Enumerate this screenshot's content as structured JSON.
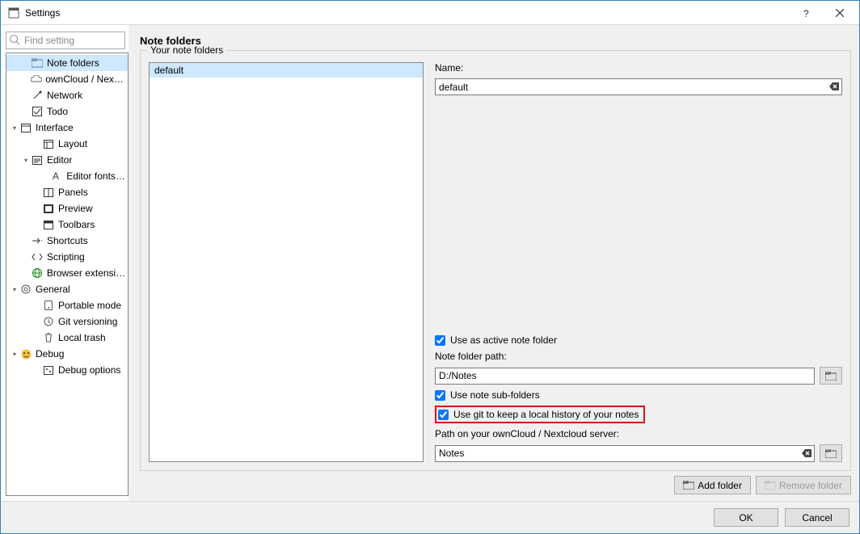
{
  "window": {
    "title": "Settings"
  },
  "sidebar": {
    "search_placeholder": "Find setting",
    "items": [
      {
        "label": "Note folders",
        "selected": true
      },
      {
        "label": "ownCloud / Nextcl..."
      },
      {
        "label": "Network"
      },
      {
        "label": "Todo"
      },
      {
        "label": "Interface"
      },
      {
        "label": "Layout"
      },
      {
        "label": "Editor"
      },
      {
        "label": "Editor fonts & ..."
      },
      {
        "label": "Panels"
      },
      {
        "label": "Preview"
      },
      {
        "label": "Toolbars"
      },
      {
        "label": "Shortcuts"
      },
      {
        "label": "Scripting"
      },
      {
        "label": "Browser extension"
      },
      {
        "label": "General"
      },
      {
        "label": "Portable mode"
      },
      {
        "label": "Git versioning"
      },
      {
        "label": "Local trash"
      },
      {
        "label": "Debug"
      },
      {
        "label": "Debug options"
      }
    ]
  },
  "panel": {
    "heading": "Note folders",
    "group_label": "Your note folders",
    "folders": [
      {
        "name": "default"
      }
    ],
    "form": {
      "name_label": "Name:",
      "name_value": "default",
      "active_checkbox": "Use as active note folder",
      "path_label": "Note folder path:",
      "path_value": "D:/Notes",
      "subfolders_checkbox": "Use note sub-folders",
      "git_checkbox": "Use git to keep a local history of your notes",
      "cloud_label": "Path on your ownCloud / Nextcloud server:",
      "cloud_value": "Notes"
    },
    "buttons": {
      "add": "Add folder",
      "remove": "Remove folder"
    }
  },
  "footer": {
    "ok": "OK",
    "cancel": "Cancel"
  }
}
